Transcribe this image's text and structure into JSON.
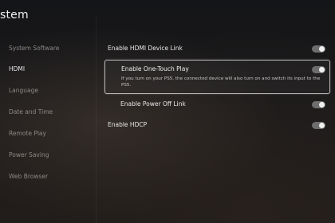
{
  "header": {
    "title": "stem"
  },
  "sidebar": {
    "items": [
      {
        "label": "System Software"
      },
      {
        "label": "HDMI"
      },
      {
        "label": "Language"
      },
      {
        "label": "Date and Time"
      },
      {
        "label": "Remote Play"
      },
      {
        "label": "Power Saving"
      },
      {
        "label": "Web Browser"
      }
    ],
    "active_index": 1
  },
  "settings": [
    {
      "label": "Enable HDMI Device Link",
      "enabled": true
    },
    {
      "label": "Enable One-Touch Play",
      "enabled": true,
      "description": "If you turn on your PS5, the connected device will also turn on and switch its input to the PS5."
    },
    {
      "label": "Enable Power Off Link",
      "enabled": true
    },
    {
      "label": "Enable HDCP",
      "enabled": true
    }
  ]
}
